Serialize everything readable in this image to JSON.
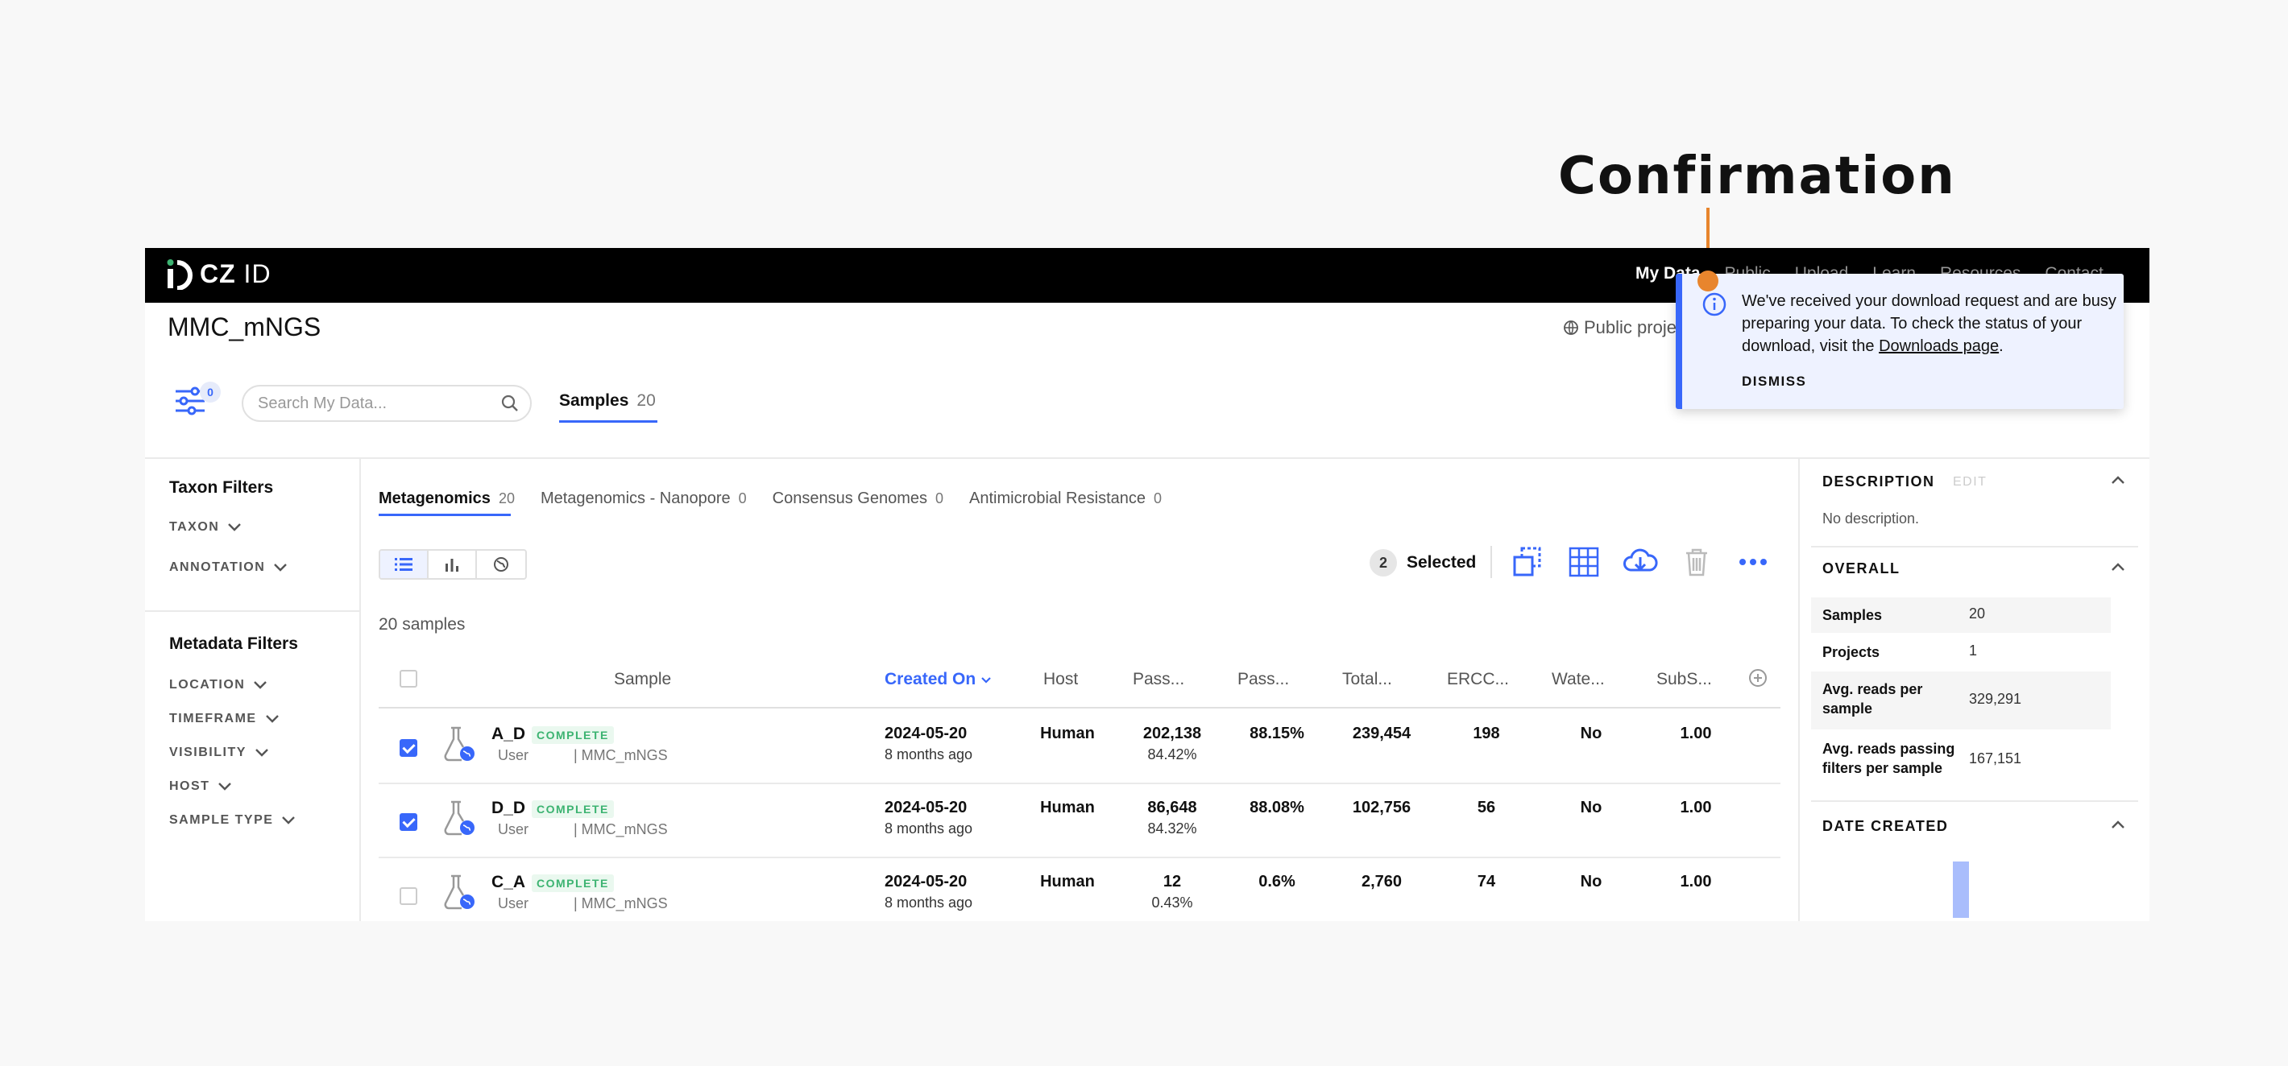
{
  "annotation": {
    "label": "Confirmation"
  },
  "nav": {
    "logo_prefix": "CZ",
    "logo_suffix": "ID",
    "links": [
      "My Data",
      "Public",
      "Upload",
      "Learn",
      "Resources",
      "Contact"
    ]
  },
  "header": {
    "project_title": "MMC_mNGS",
    "public_label": "Public project",
    "filter_count": "0",
    "search_placeholder": "Search My Data...",
    "tab_label": "Samples",
    "tab_count": "20"
  },
  "filters": {
    "taxon_title": "Taxon Filters",
    "taxon_items": [
      "TAXON",
      "ANNOTATION"
    ],
    "metadata_title": "Metadata Filters",
    "metadata_items": [
      "LOCATION",
      "TIMEFRAME",
      "VISIBILITY",
      "HOST",
      "SAMPLE TYPE"
    ]
  },
  "workflow_tabs": [
    {
      "label": "Metagenomics",
      "count": "20"
    },
    {
      "label": "Metagenomics - Nanopore",
      "count": "0"
    },
    {
      "label": "Consensus Genomes",
      "count": "0"
    },
    {
      "label": "Antimicrobial Resistance",
      "count": "0"
    }
  ],
  "toolbar": {
    "selected_count": "2",
    "selected_label": "Selected"
  },
  "sample_count": "20 samples",
  "table": {
    "headers": [
      "Sample",
      "Created On",
      "Host",
      "Pass...",
      "Pass...",
      "Total...",
      "ERCC...",
      "Wate...",
      "SubS..."
    ],
    "rows": [
      {
        "checked": true,
        "name": "A_D",
        "status": "COMPLETE",
        "user": "User",
        "project": "| MMC_mNGS",
        "date": "2024-05-20",
        "ago": "8 months ago",
        "host": "Human",
        "pass1": "202,138",
        "pass1_sub": "84.42%",
        "pass2": "88.15%",
        "total": "239,454",
        "ercc": "198",
        "water": "No",
        "subs": "1.00"
      },
      {
        "checked": true,
        "name": "D_D",
        "status": "COMPLETE",
        "user": "User",
        "project": "| MMC_mNGS",
        "date": "2024-05-20",
        "ago": "8 months ago",
        "host": "Human",
        "pass1": "86,648",
        "pass1_sub": "84.32%",
        "pass2": "88.08%",
        "total": "102,756",
        "ercc": "56",
        "water": "No",
        "subs": "1.00"
      },
      {
        "checked": false,
        "name": "C_A",
        "status": "COMPLETE",
        "user": "User",
        "project": "| MMC_mNGS",
        "date": "2024-05-20",
        "ago": "8 months ago",
        "host": "Human",
        "pass1": "12",
        "pass1_sub": "0.43%",
        "pass2": "0.6%",
        "total": "2,760",
        "ercc": "74",
        "water": "No",
        "subs": "1.00"
      }
    ]
  },
  "right_panel": {
    "description_title": "DESCRIPTION",
    "edit_label": "EDIT",
    "description_text": "No description.",
    "overall_title": "OVERALL",
    "stats": [
      {
        "label": "Samples",
        "value": "20"
      },
      {
        "label": "Projects",
        "value": "1"
      },
      {
        "label": "Avg. reads per sample",
        "value": "329,291"
      },
      {
        "label": "Avg. reads passing filters per sample",
        "value": "167,151"
      }
    ],
    "date_created_title": "DATE CREATED"
  },
  "toast": {
    "message": "We've received your download request and are busy preparing your data. To check the status of your download, visit the",
    "link": "Downloads page",
    "dismiss": "DISMISS"
  },
  "colors": {
    "accent": "#3867fa",
    "annotation": "#e8852d",
    "complete": "#3cb371"
  }
}
